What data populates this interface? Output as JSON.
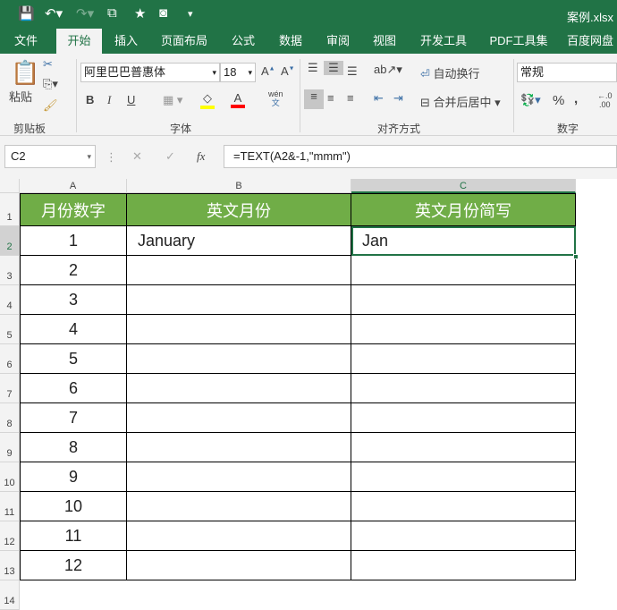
{
  "title": "案例.xlsx",
  "tabs": [
    "文件",
    "开始",
    "插入",
    "页面布局",
    "公式",
    "数据",
    "审阅",
    "视图",
    "开发工具",
    "PDF工具集",
    "百度网盘"
  ],
  "ribbon": {
    "paste": "粘贴",
    "clipboard": "剪贴板",
    "font_name": "阿里巴巴普惠体",
    "font_size": "18",
    "font_group": "字体",
    "bold": "B",
    "italic": "I",
    "underline": "U",
    "wen": "wén",
    "wrap": "自动换行",
    "merge": "合并后居中",
    "align_group": "对齐方式",
    "number_format": "常规",
    "percent": "%",
    "comma": ",",
    "number_group": "数字"
  },
  "formula_bar": {
    "name_box": "C2",
    "fx": "fx",
    "formula": "=TEXT(A2&-1,\"mmm\")"
  },
  "columns": [
    "A",
    "B",
    "C"
  ],
  "headers": [
    "月份数字",
    "英文月份",
    "英文月份简写"
  ],
  "rows": [
    [
      "1",
      "January",
      "Jan"
    ],
    [
      "2",
      "",
      ""
    ],
    [
      "3",
      "",
      ""
    ],
    [
      "4",
      "",
      ""
    ],
    [
      "5",
      "",
      ""
    ],
    [
      "6",
      "",
      ""
    ],
    [
      "7",
      "",
      ""
    ],
    [
      "8",
      "",
      ""
    ],
    [
      "9",
      "",
      ""
    ],
    [
      "10",
      "",
      ""
    ],
    [
      "11",
      "",
      ""
    ],
    [
      "12",
      "",
      ""
    ]
  ],
  "row_numbers": [
    "1",
    "2",
    "3",
    "4",
    "5",
    "6",
    "7",
    "8",
    "9",
    "10",
    "11",
    "12",
    "13",
    "14"
  ],
  "colors": {
    "accent": "#217346",
    "header_fill": "#70ad47"
  }
}
